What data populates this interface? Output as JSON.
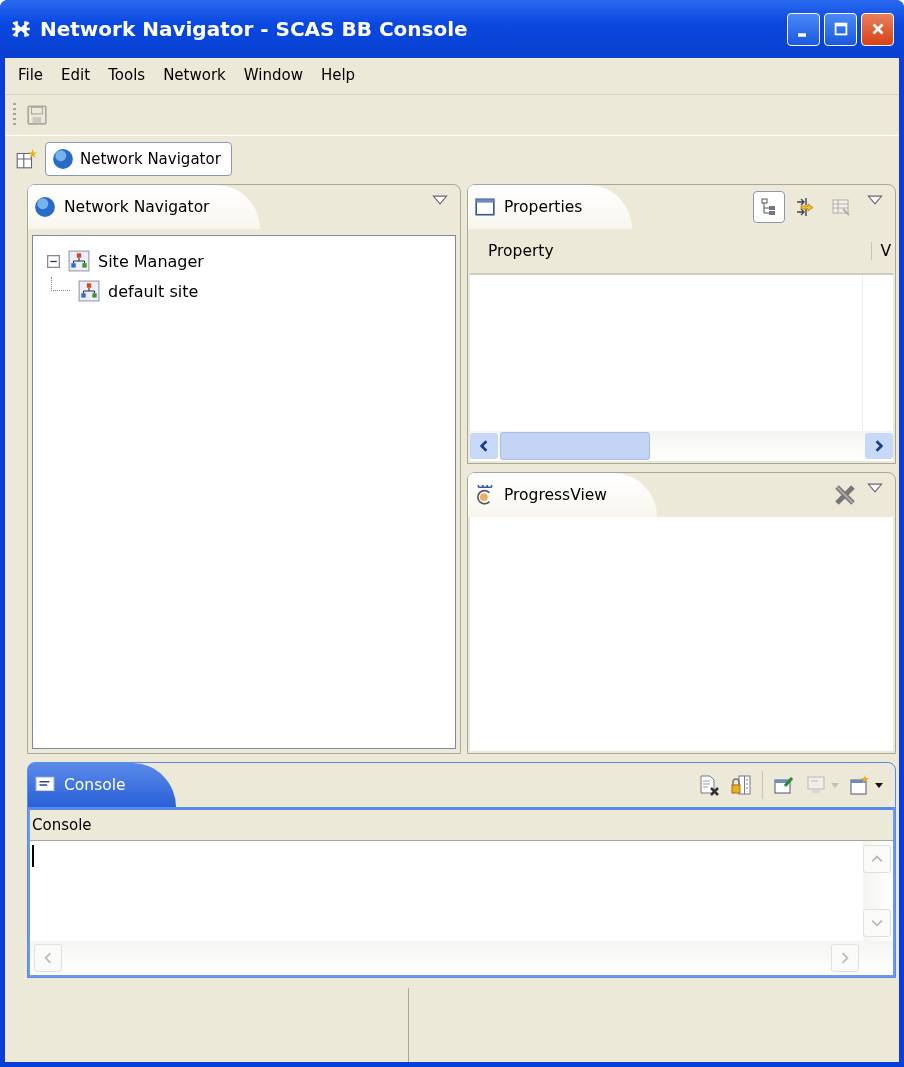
{
  "window": {
    "title": "Network Navigator - SCAS BB Console"
  },
  "menu": [
    {
      "label": "File"
    },
    {
      "label": "Edit"
    },
    {
      "label": "Tools"
    },
    {
      "label": "Network"
    },
    {
      "label": "Window"
    },
    {
      "label": "Help"
    }
  ],
  "toolbar": [
    {
      "kind": "save",
      "disabled": true
    }
  ],
  "perspectives": [
    {
      "label": "Network Navigator",
      "selected": true
    }
  ],
  "navigator": {
    "tab": "Network Navigator",
    "tree": [
      {
        "label": "Site Manager",
        "expanded": true,
        "children": [
          {
            "label": "default site"
          }
        ]
      }
    ]
  },
  "properties": {
    "tab": "Properties",
    "tools": [
      {
        "kind": "categories",
        "selected": true,
        "disabled": false
      },
      {
        "kind": "advanced",
        "selected": false,
        "disabled": false
      },
      {
        "kind": "defaults",
        "selected": false,
        "disabled": true
      }
    ],
    "columns": [
      "Property",
      "V"
    ]
  },
  "progress": {
    "tab": "ProgressView"
  },
  "console": {
    "tab": "Console",
    "selected": true,
    "header": "Console"
  }
}
